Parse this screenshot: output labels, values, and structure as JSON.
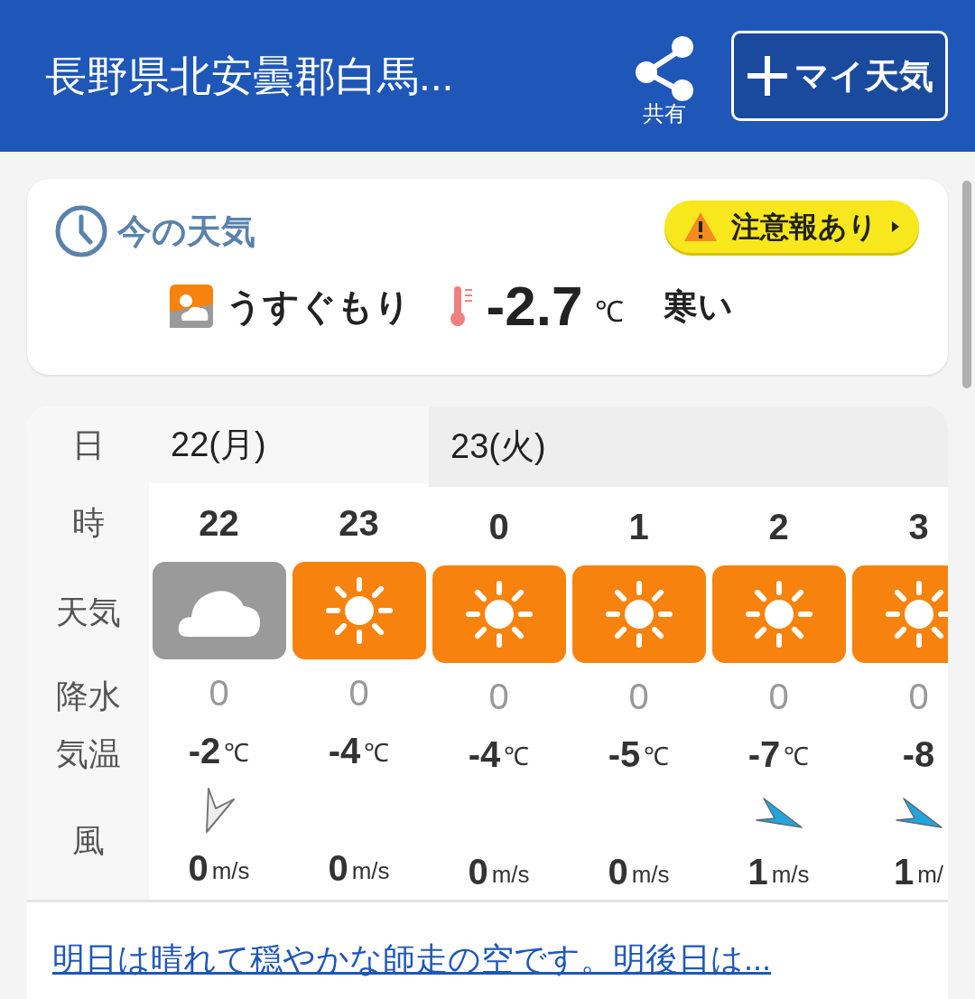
{
  "header": {
    "title": "長野県北安曇郡白馬...",
    "share_label": "共有",
    "my_weather_button": "マイ天気"
  },
  "current": {
    "heading": "今の天気",
    "alert": "注意報あり",
    "condition": "うすぐもり",
    "temperature": "-2.7",
    "unit": "℃",
    "feeling": "寒い"
  },
  "forecast": {
    "row_labels": {
      "day": "日",
      "hour": "時",
      "weather": "天気",
      "precip": "降水",
      "temp": "気温",
      "wind": "風"
    },
    "days": [
      {
        "label": "22(月)",
        "hours": [
          {
            "hour": "22",
            "weather_icon": {
              "kind": "cloudy"
            },
            "precip": "0",
            "temp": "-2",
            "temp_unit": "℃",
            "wind_arrow": {
              "kind": "calm"
            },
            "wind": "0",
            "wind_unit": "m/s"
          },
          {
            "hour": "23",
            "weather_icon": {
              "kind": "sunny"
            },
            "precip": "0",
            "temp": "-4",
            "temp_unit": "℃",
            "wind": "0",
            "wind_unit": "m/s"
          }
        ]
      },
      {
        "label": "23(火)",
        "hours": [
          {
            "hour": "0",
            "weather_icon": {
              "kind": "sunny"
            },
            "precip": "0",
            "temp": "-4",
            "temp_unit": "℃",
            "wind": "0",
            "wind_unit": "m/s"
          },
          {
            "hour": "1",
            "weather_icon": {
              "kind": "sunny"
            },
            "precip": "0",
            "temp": "-5",
            "temp_unit": "℃",
            "wind": "0",
            "wind_unit": "m/s"
          },
          {
            "hour": "2",
            "weather_icon": {
              "kind": "sunny"
            },
            "precip": "0",
            "temp": "-7",
            "temp_unit": "℃",
            "wind_arrow": {
              "kind": "arrow"
            },
            "wind": "1",
            "wind_unit": "m/s"
          },
          {
            "hour": "3",
            "weather_icon": {
              "kind": "sunny"
            },
            "precip": "0",
            "temp": "-8",
            "wind_arrow": {
              "kind": "arrow"
            },
            "wind": "1",
            "wind_unit": "m/"
          }
        ]
      }
    ],
    "summary_link": "明日は晴れて穏やかな師走の空です。明後日は..."
  }
}
